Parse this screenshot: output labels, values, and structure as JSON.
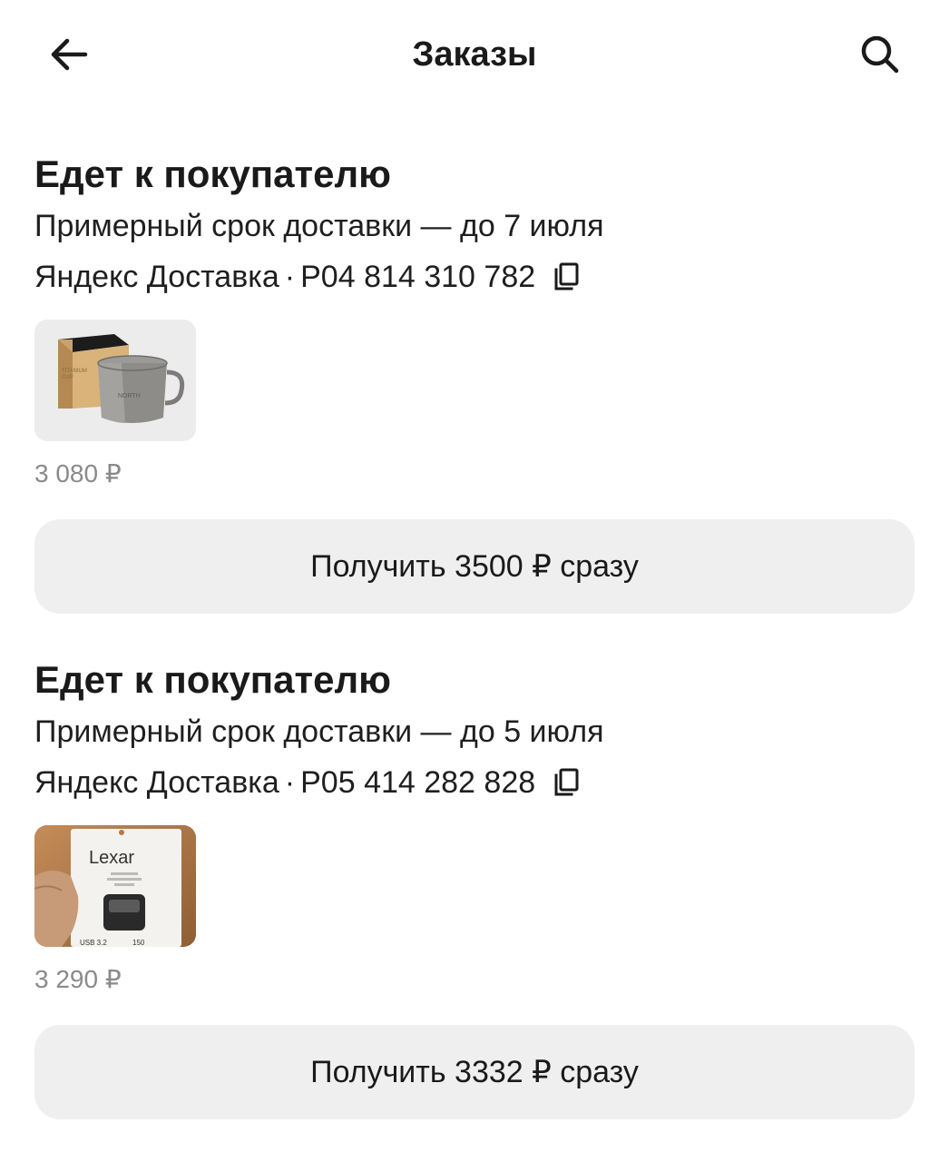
{
  "header": {
    "title": "Заказы",
    "back_icon": "arrow-left-icon",
    "search_icon": "search-icon"
  },
  "orders": [
    {
      "status": "Едет к покупателю",
      "delivery_estimate": "Примерный срок доставки — до 7 июля",
      "carrier": "Яндекс Доставка",
      "separator": "·",
      "tracking_number": "P04 814 310 782",
      "copy_icon": "copy-icon",
      "product_image": "titanium-mug-with-box",
      "price": "3 080 ₽",
      "action_label": "Получить 3500 ₽ сразу"
    },
    {
      "status": "Едет к покупателю",
      "delivery_estimate": "Примерный срок доставки — до 5 июля",
      "carrier": "Яндекс Доставка",
      "separator": "·",
      "tracking_number": "P05 414 282 828",
      "copy_icon": "copy-icon",
      "product_image": "lexar-usb-flash-drive",
      "price": "3 290 ₽",
      "action_label": "Получить 3332 ₽ сразу"
    }
  ],
  "colors": {
    "background": "#ffffff",
    "text": "#1a1a1a",
    "price_text": "#8a8a8a",
    "button_bg": "#efefef"
  }
}
